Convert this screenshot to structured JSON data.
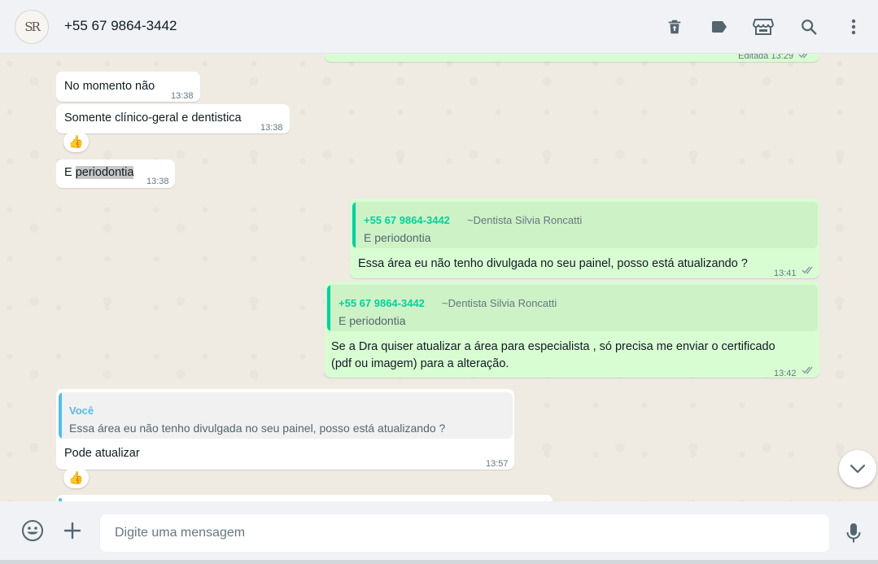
{
  "header": {
    "contact_name": "+55 67 9864-3442",
    "avatar_monogram": "SR",
    "icons": [
      "delete-icon",
      "label-icon",
      "store-icon",
      "search-icon",
      "menu-icon"
    ]
  },
  "messages": [
    {
      "id": "m0",
      "direction": "out",
      "partial": true,
      "time": "Editada 13:29",
      "ticks": "read"
    },
    {
      "id": "m1",
      "direction": "in",
      "text": "No momento não",
      "time": "13:38"
    },
    {
      "id": "m2",
      "direction": "in",
      "text": "Somente clínico-geral e dentistica",
      "time": "13:38",
      "reaction": "👍"
    },
    {
      "id": "m3",
      "direction": "in",
      "text_before": "E ",
      "text_highlight": "periodontia",
      "time": "13:38"
    },
    {
      "id": "m4",
      "direction": "out",
      "quote": {
        "name": "+55 67 9864-3442",
        "pushname": "~Dentista Silvia Roncatti",
        "text": "E periodontia"
      },
      "text": "Essa área eu não tenho divulgada no seu painel, posso está atualizando ?",
      "time": "13:41",
      "ticks": "read"
    },
    {
      "id": "m5",
      "direction": "out",
      "quote": {
        "name": "+55 67 9864-3442",
        "pushname": "~Dentista Silvia Roncatti",
        "text": "E periodontia"
      },
      "lines": [
        "Se a Dra quiser atualizar a área para especialista , só precisa me enviar o certificado",
        "(pdf ou imagem) para a alteração."
      ],
      "time": "13:42",
      "ticks": "read"
    },
    {
      "id": "m6",
      "direction": "in",
      "quote": {
        "name": "Você",
        "text": "Essa área eu não tenho divulgada no seu painel, posso está atualizando ?"
      },
      "text": "Pode atualizar",
      "time": "13:57",
      "reaction": "👍"
    }
  ],
  "composer": {
    "placeholder": "Digite uma mensagem",
    "value": ""
  },
  "colors": {
    "outgoing_bubble": "#d9fdd3",
    "incoming_bubble": "#ffffff",
    "quote_name_out": "#06cf9c",
    "quote_name_self": "#53bdeb",
    "read_ticks": "#8696a0",
    "header_bg": "#f0f2f5"
  }
}
